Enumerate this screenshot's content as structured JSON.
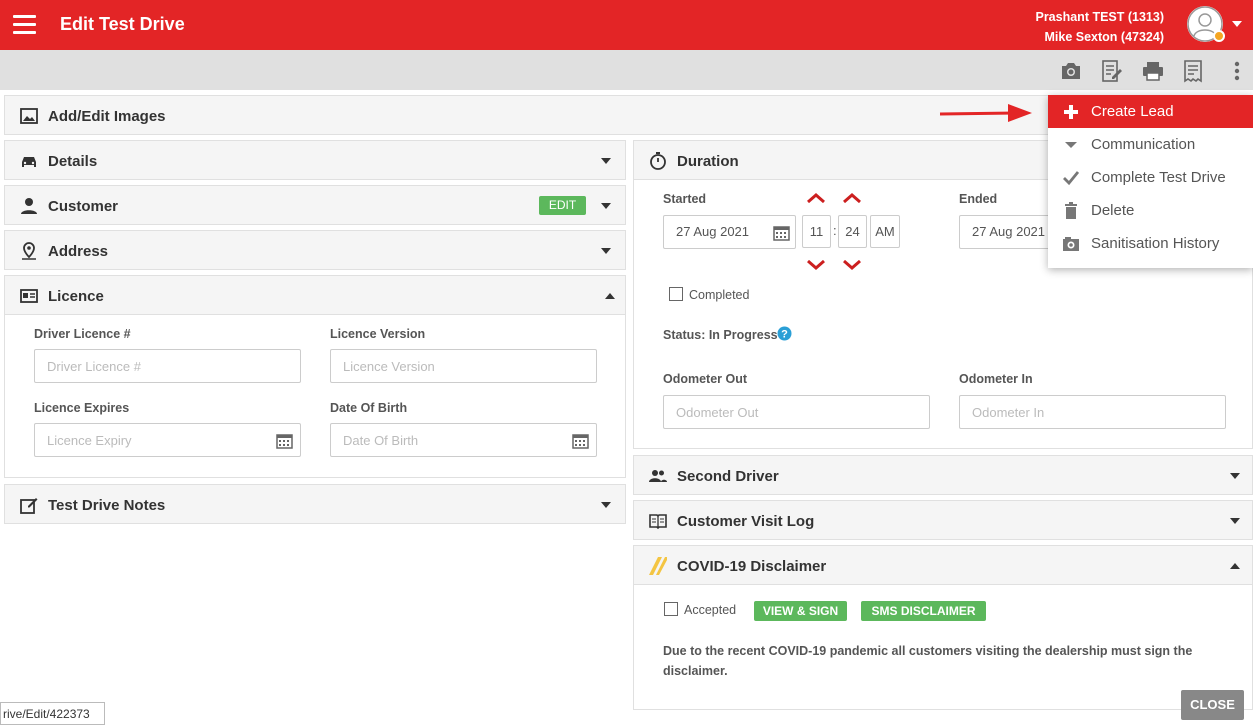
{
  "header": {
    "title": "Edit Test Drive",
    "user_line1": "Prashant TEST (1313)",
    "user_line2": "Mike Sexton (47324)"
  },
  "toolbar": {
    "icons": [
      "camera-icon",
      "edit-document-icon",
      "print-icon",
      "receipt-icon",
      "more-vert-icon"
    ]
  },
  "left_panels": {
    "images": "Add/Edit Images",
    "details": "Details",
    "customer": "Customer",
    "customer_edit": "EDIT",
    "address": "Address",
    "licence": "Licence",
    "notes": "Test Drive Notes"
  },
  "licence_form": {
    "driver_licence_label": "Driver Licence #",
    "driver_licence_placeholder": "Driver Licence #",
    "licence_version_label": "Licence Version",
    "licence_version_placeholder": "Licence Version",
    "licence_expires_label": "Licence Expires",
    "licence_expires_placeholder": "Licence Expiry",
    "dob_label": "Date Of Birth",
    "dob_placeholder": "Date Of Birth"
  },
  "duration": {
    "title": "Duration",
    "started_label": "Started",
    "started_date": "27 Aug 2021",
    "started_hour": "11",
    "started_minute": "24",
    "started_ampm": "AM",
    "ended_label": "Ended",
    "ended_date": "27 Aug 2021",
    "completed_label": "Completed",
    "status_text": "Status: In Progress",
    "odometer_out_label": "Odometer Out",
    "odometer_out_placeholder": "Odometer Out",
    "odometer_in_label": "Odometer In",
    "odometer_in_placeholder": "Odometer In"
  },
  "right_panels": {
    "second_driver": "Second Driver",
    "visit_log": "Customer Visit Log",
    "covid": "COVID-19 Disclaimer"
  },
  "covid": {
    "accepted_label": "Accepted",
    "view_sign": "VIEW & SIGN",
    "sms": "SMS DISCLAIMER",
    "text": "Due to the recent COVID-19 pandemic all customers visiting the dealership must sign the disclaimer."
  },
  "menu": {
    "items": [
      {
        "label": "Create Lead",
        "icon": "plus-icon"
      },
      {
        "label": "Communication",
        "icon": "caret-down-icon"
      },
      {
        "label": "Complete Test Drive",
        "icon": "check-icon"
      },
      {
        "label": "Delete",
        "icon": "trash-icon"
      },
      {
        "label": "Sanitisation History",
        "icon": "history-icon"
      }
    ]
  },
  "url_hint": "rive/Edit/422373",
  "close_label": "CLOSE",
  "colors": {
    "brand_red": "#e32526",
    "green": "#5cb85c",
    "panel_bg": "#f5f5f5",
    "toolbar_bg": "#e0e0e0"
  }
}
